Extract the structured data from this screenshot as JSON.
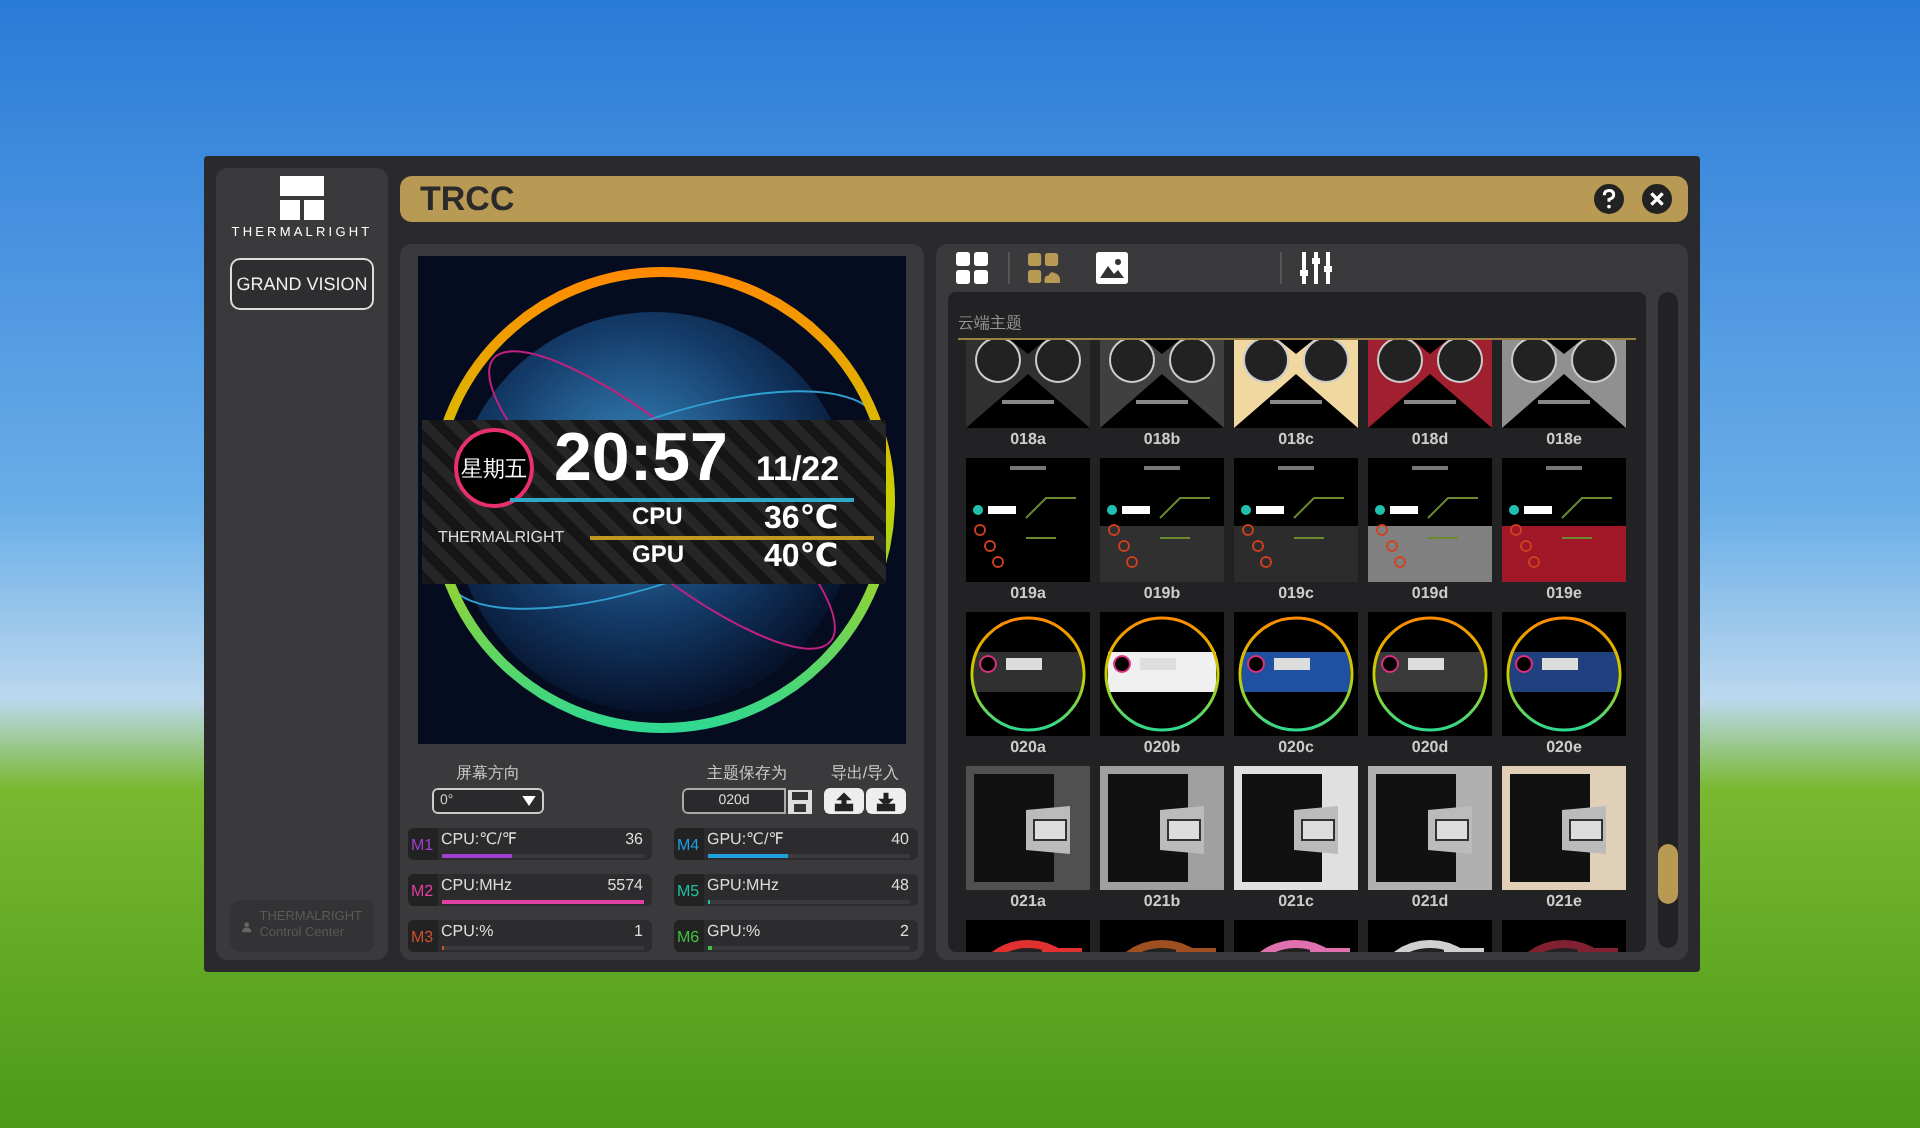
{
  "window": {
    "title": "TRCC"
  },
  "sidebar": {
    "brand": "THERMALRIGHT",
    "device_button": "GRAND VISION",
    "footer": [
      "THERMALRIGHT",
      "Control Center"
    ]
  },
  "preview": {
    "weekday": "星期五",
    "time": "20:57",
    "date": "11/22",
    "brand": "THERMALRIGHT",
    "readings": [
      {
        "label": "CPU",
        "value": "36℃"
      },
      {
        "label": "GPU",
        "value": "40℃"
      }
    ]
  },
  "controls": {
    "rotation_label": "屏幕方向",
    "rotation_value": "0°",
    "save_label": "主题保存为",
    "save_value": "020d",
    "export_label": "导出/导入"
  },
  "metrics": [
    {
      "slot": "M1",
      "label": "CPU:℃/℉",
      "value": "36",
      "level": 0.35,
      "color": "#a040d0"
    },
    {
      "slot": "M4",
      "label": "GPU:℃/℉",
      "value": "40",
      "level": 0.4,
      "color": "#20a0e0"
    },
    {
      "slot": "M2",
      "label": "CPU:MHz",
      "value": "5574",
      "level": 1,
      "color": "#e040a0"
    },
    {
      "slot": "M5",
      "label": "GPU:MHz",
      "value": "48",
      "level": 0.01,
      "color": "#20c0a0"
    },
    {
      "slot": "M3",
      "label": "CPU:%",
      "value": "1",
      "level": 0.01,
      "color": "#d05030"
    },
    {
      "slot": "M6",
      "label": "GPU:%",
      "value": "2",
      "level": 0.02,
      "color": "#40c040"
    }
  ],
  "toolbar": [
    {
      "kind": "grid",
      "selected": false
    },
    {
      "kind": "cloud",
      "selected": true
    },
    {
      "kind": "image",
      "selected": false
    },
    {
      "kind": "mixer",
      "selected": false
    }
  ],
  "gallery": {
    "section": "云端主题",
    "rows": [
      {
        "kind": "dual",
        "items": [
          {
            "name": "018a",
            "color": "#303030"
          },
          {
            "name": "018b",
            "color": "#404040"
          },
          {
            "name": "018c",
            "color": "#f0d8a0"
          },
          {
            "name": "018d",
            "color": "#a02030"
          },
          {
            "name": "018e",
            "color": "#909090"
          }
        ]
      },
      {
        "kind": "dash",
        "items": [
          {
            "name": "019a",
            "color": "#000000"
          },
          {
            "name": "019b",
            "color": "#303030"
          },
          {
            "name": "019c",
            "color": "#2c2c2c"
          },
          {
            "name": "019d",
            "color": "#808080"
          },
          {
            "name": "019e",
            "color": "#a01828"
          }
        ]
      },
      {
        "kind": "ring",
        "items": [
          {
            "name": "020a",
            "color": "#303030"
          },
          {
            "name": "020b",
            "color": "#f0f0f0"
          },
          {
            "name": "020c",
            "color": "#2050a0"
          },
          {
            "name": "020d",
            "color": "#3a3a3a"
          },
          {
            "name": "020e",
            "color": "#204080"
          }
        ]
      },
      {
        "kind": "panel",
        "items": [
          {
            "name": "021a",
            "color": "#505050"
          },
          {
            "name": "021b",
            "color": "#a0a0a0"
          },
          {
            "name": "021c",
            "color": "#e0e0e0"
          },
          {
            "name": "021d",
            "color": "#b0b0b0"
          },
          {
            "name": "021e",
            "color": "#e0d0b8"
          }
        ]
      },
      {
        "kind": "radial",
        "items": [
          {
            "color": "#e03030"
          },
          {
            "color": "#a05020"
          },
          {
            "color": "#e070b0"
          },
          {
            "color": "#d0d0d0"
          },
          {
            "color": "#802030"
          }
        ]
      }
    ]
  }
}
